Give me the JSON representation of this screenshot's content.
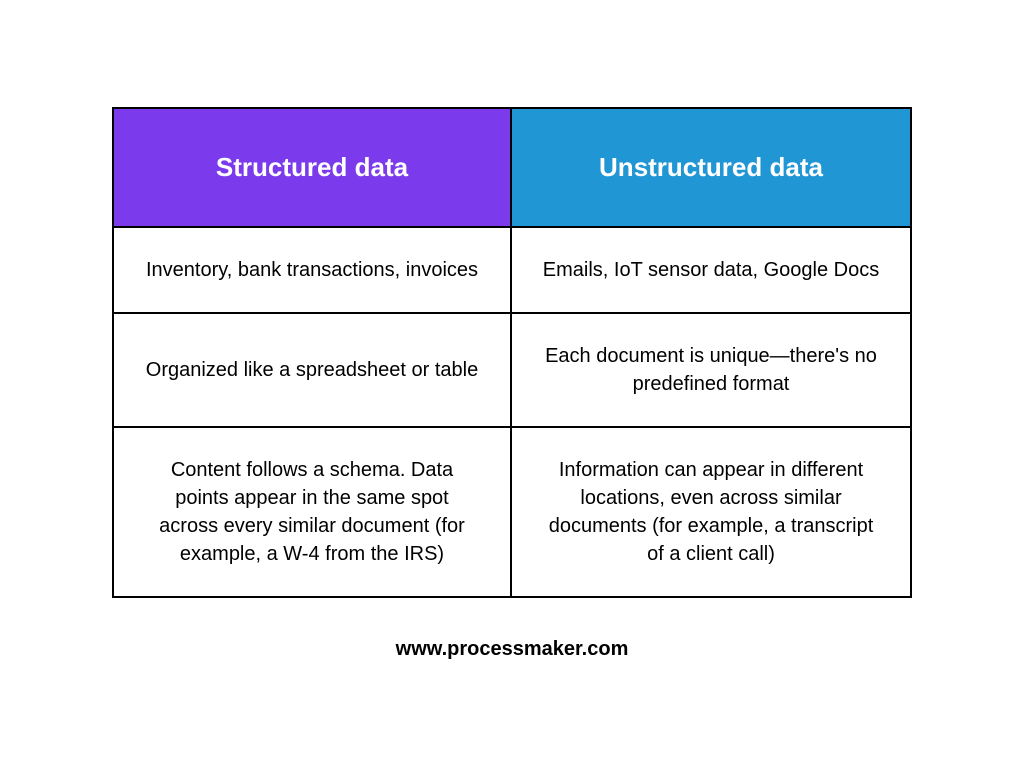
{
  "chart_data": {
    "type": "table",
    "columns": [
      "Structured data",
      "Unstructured data"
    ],
    "rows": [
      [
        "Inventory, bank transactions, invoices",
        "Emails, IoT sensor data, Google Docs"
      ],
      [
        "Organized like a spreadsheet or table",
        "Each document is unique—there's no predefined format"
      ],
      [
        "Content follows a schema. Data points appear in the same spot across every similar document (for example, a W-4 from the IRS)",
        "Information can appear in different locations, even across similar documents (for example, a transcript of a client call)"
      ]
    ]
  },
  "headers": {
    "left": "Structured data",
    "right": "Unstructured data"
  },
  "rows": [
    {
      "left": "Inventory, bank transactions, invoices",
      "right": "Emails, IoT sensor data, Google Docs"
    },
    {
      "left": "Organized like a spreadsheet or table",
      "right": "Each document is unique—there's no predefined format"
    },
    {
      "left": "Content follows a schema. Data points appear in the same spot across every similar document (for example, a W-4 from the IRS)",
      "right": "Information can appear in different locations, even across similar documents (for example, a transcript of a client call)"
    }
  ],
  "footer": "www.processmaker.com",
  "colors": {
    "header_left_bg": "#7c3aed",
    "header_right_bg": "#2196d4",
    "border": "#000000",
    "text": "#000000",
    "header_text": "#ffffff"
  }
}
